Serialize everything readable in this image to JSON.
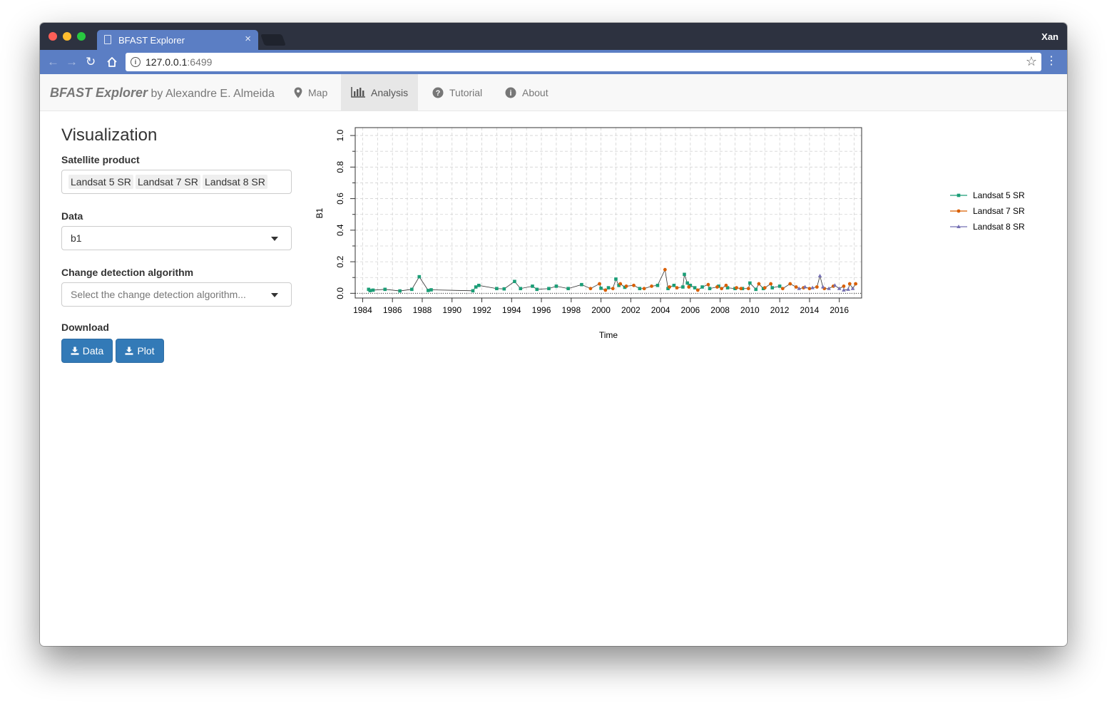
{
  "browser": {
    "tab_title": "BFAST Explorer",
    "tab_close": "×",
    "user": "Xan",
    "url_host": "127.0.0.1",
    "url_port": ":6499",
    "info_glyph": "i",
    "star_glyph": "☆",
    "menu_glyph": "⋮",
    "back_glyph": "←",
    "forward_glyph": "→",
    "reload_glyph": "↻"
  },
  "navbar": {
    "brand_name": "BFAST Explorer",
    "brand_by": " by Alexandre E. Almeida",
    "items": [
      {
        "label": "Map",
        "icon": "map-marker-icon",
        "active": false
      },
      {
        "label": "Analysis",
        "icon": "bar-chart-icon",
        "active": true
      },
      {
        "label": "Tutorial",
        "icon": "question-circle-icon",
        "active": false
      },
      {
        "label": "About",
        "icon": "info-circle-icon",
        "active": false
      }
    ]
  },
  "sidebar": {
    "title": "Visualization",
    "satellite_label": "Satellite product",
    "satellite_values": [
      "Landsat 5 SR",
      "Landsat 7 SR",
      "Landsat 8 SR"
    ],
    "data_label": "Data",
    "data_value": "b1",
    "algorithm_label": "Change detection algorithm",
    "algorithm_placeholder": "Select the change detection algorithm...",
    "download_label": "Download",
    "download_data_label": "Data",
    "download_plot_label": "Plot"
  },
  "colors": {
    "landsat5": "#1b9e77",
    "landsat7": "#d95f02",
    "landsat8": "#7570b3",
    "primary_button": "#337ab7"
  },
  "chart_data": {
    "type": "line",
    "xlabel": "Time",
    "ylabel": "B1",
    "xlim": [
      1983.5,
      2017.5
    ],
    "ylim": [
      -0.03,
      1.05
    ],
    "x_ticks": [
      1984,
      1986,
      1988,
      1990,
      1992,
      1994,
      1996,
      1998,
      2000,
      2002,
      2004,
      2006,
      2008,
      2010,
      2012,
      2014,
      2016
    ],
    "y_ticks": [
      0.0,
      0.2,
      0.4,
      0.6,
      0.8,
      1.0
    ],
    "grid": true,
    "reference_line_y": 0.0,
    "legend_position": "right",
    "series": [
      {
        "name": "Landsat 5 SR",
        "marker": "square",
        "color": "#1b9e77",
        "points": [
          [
            1984.4,
            0.025
          ],
          [
            1984.5,
            0.017
          ],
          [
            1984.7,
            0.02
          ],
          [
            1985.5,
            0.025
          ],
          [
            1986.5,
            0.015
          ],
          [
            1987.3,
            0.025
          ],
          [
            1987.8,
            0.105
          ],
          [
            1988.4,
            0.018
          ],
          [
            1988.6,
            0.022
          ],
          [
            1991.4,
            0.016
          ],
          [
            1991.6,
            0.04
          ],
          [
            1991.8,
            0.05
          ],
          [
            1993.0,
            0.03
          ],
          [
            1993.5,
            0.028
          ],
          [
            1994.2,
            0.075
          ],
          [
            1994.6,
            0.03
          ],
          [
            1995.4,
            0.045
          ],
          [
            1995.7,
            0.025
          ],
          [
            1996.5,
            0.03
          ],
          [
            1997.0,
            0.045
          ],
          [
            1997.8,
            0.03
          ],
          [
            1998.7,
            0.055
          ],
          [
            2000.0,
            0.032
          ],
          [
            2000.5,
            0.035
          ],
          [
            2001.0,
            0.09
          ],
          [
            2001.2,
            0.05
          ],
          [
            2001.6,
            0.038
          ],
          [
            2002.6,
            0.03
          ],
          [
            2003.8,
            0.05
          ],
          [
            2004.5,
            0.03
          ],
          [
            2004.9,
            0.05
          ],
          [
            2005.5,
            0.04
          ],
          [
            2005.6,
            0.12
          ],
          [
            2005.8,
            0.065
          ],
          [
            2006.0,
            0.05
          ],
          [
            2006.3,
            0.035
          ],
          [
            2006.8,
            0.04
          ],
          [
            2007.3,
            0.03
          ],
          [
            2007.9,
            0.045
          ],
          [
            2008.5,
            0.035
          ],
          [
            2009.0,
            0.03
          ],
          [
            2009.5,
            0.03
          ],
          [
            2010.0,
            0.065
          ],
          [
            2010.4,
            0.025
          ],
          [
            2010.9,
            0.03
          ],
          [
            2011.5,
            0.035
          ],
          [
            2012.0,
            0.045
          ]
        ]
      },
      {
        "name": "Landsat 7 SR",
        "marker": "circle",
        "color": "#d95f02",
        "points": [
          [
            1999.3,
            0.03
          ],
          [
            1999.9,
            0.06
          ],
          [
            2000.3,
            0.02
          ],
          [
            2000.8,
            0.03
          ],
          [
            2001.3,
            0.06
          ],
          [
            2001.7,
            0.045
          ],
          [
            2002.2,
            0.05
          ],
          [
            2002.9,
            0.03
          ],
          [
            2003.4,
            0.045
          ],
          [
            2004.3,
            0.15
          ],
          [
            2004.6,
            0.04
          ],
          [
            2005.1,
            0.035
          ],
          [
            2005.9,
            0.04
          ],
          [
            2006.5,
            0.02
          ],
          [
            2007.2,
            0.055
          ],
          [
            2007.8,
            0.04
          ],
          [
            2008.1,
            0.03
          ],
          [
            2008.4,
            0.05
          ],
          [
            2009.1,
            0.035
          ],
          [
            2009.4,
            0.03
          ],
          [
            2009.9,
            0.03
          ],
          [
            2010.6,
            0.06
          ],
          [
            2011.0,
            0.035
          ],
          [
            2011.4,
            0.06
          ],
          [
            2012.2,
            0.03
          ],
          [
            2012.7,
            0.06
          ],
          [
            2013.1,
            0.04
          ],
          [
            2013.6,
            0.035
          ],
          [
            2014.0,
            0.03
          ],
          [
            2014.5,
            0.04
          ],
          [
            2015.0,
            0.03
          ],
          [
            2015.6,
            0.045
          ],
          [
            2016.3,
            0.045
          ],
          [
            2016.7,
            0.06
          ],
          [
            2017.1,
            0.06
          ]
        ]
      },
      {
        "name": "Landsat 8 SR",
        "marker": "triangle",
        "color": "#7570b3",
        "points": [
          [
            2013.3,
            0.03
          ],
          [
            2013.7,
            0.04
          ],
          [
            2014.2,
            0.035
          ],
          [
            2014.7,
            0.11
          ],
          [
            2014.9,
            0.04
          ],
          [
            2015.3,
            0.03
          ],
          [
            2015.7,
            0.05
          ],
          [
            2016.0,
            0.03
          ],
          [
            2016.3,
            0.02
          ],
          [
            2016.6,
            0.025
          ],
          [
            2016.9,
            0.03
          ]
        ]
      }
    ]
  }
}
